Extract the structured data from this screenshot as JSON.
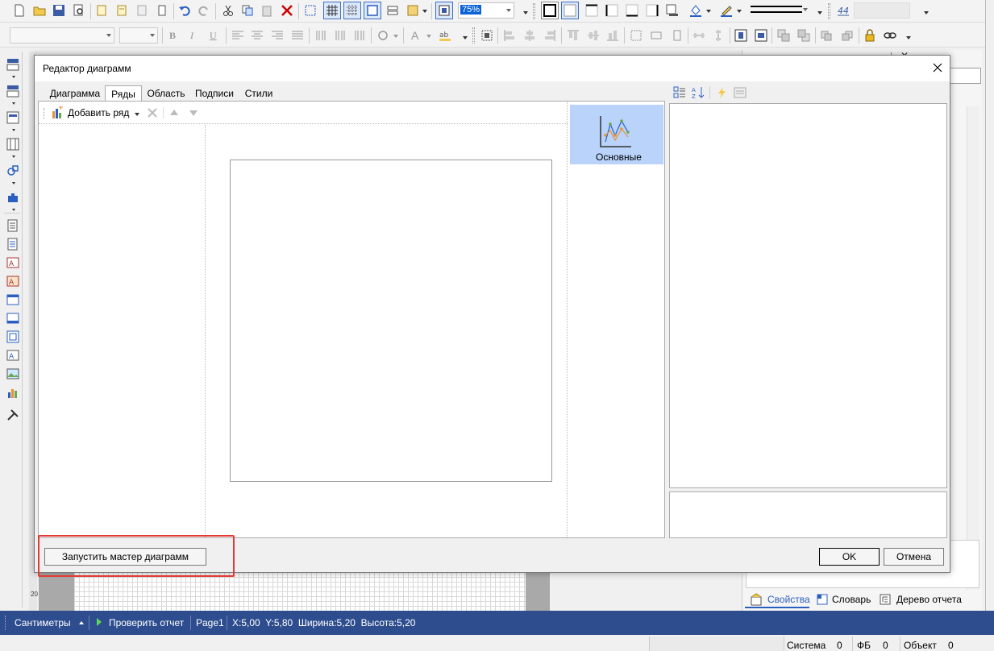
{
  "toolbar": {
    "zoom_value": "75%"
  },
  "dialog": {
    "title": "Редактор диаграмм",
    "tabs": [
      "Диаграмма",
      "Ряды",
      "Область",
      "Подписи",
      "Стили"
    ],
    "active_tab": "Ряды",
    "add_series_label": "Добавить ряд",
    "series_type_label": "Основные",
    "wizard_button": "Запустить мастер диаграмм",
    "ok_button": "OK",
    "cancel_button": "Отмена"
  },
  "right_panel": {
    "tabs": [
      "Свойства",
      "Словарь",
      "Дерево отчета"
    ]
  },
  "left_ruler": {
    "label": "20"
  },
  "statusbar": {
    "units": "Сантиметры",
    "check_report": "Проверить отчет",
    "page": "Page1",
    "coords": "X:5,00  Y:5,80  Ширина:5,20  Высота:5,20"
  },
  "bottombar": {
    "system_label": "Система",
    "system_value": "0",
    "fb_label": "ФБ",
    "fb_value": "0",
    "object_label": "Объект",
    "object_value": "0"
  },
  "colors": {
    "accent": "#2e4d8f",
    "highlight": "#b9d3fb",
    "annotation_red": "#e53935"
  }
}
